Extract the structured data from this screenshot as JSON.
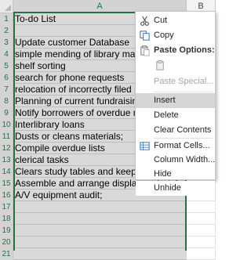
{
  "grid": {
    "columns": [
      "A",
      "B"
    ],
    "rows": [
      {
        "num": "1",
        "text": "To-do List"
      },
      {
        "num": "2",
        "text": ""
      },
      {
        "num": "3",
        "text": "Update customer Database"
      },
      {
        "num": "4",
        "text": "simple mending of library material"
      },
      {
        "num": "5",
        "text": "shelf sorting"
      },
      {
        "num": "6",
        "text": "search for phone requests"
      },
      {
        "num": "7",
        "text": "relocation of incorrectly filed mate"
      },
      {
        "num": "8",
        "text": "Planning of current fundraising driv"
      },
      {
        "num": "9",
        "text": "Notify borrowers of overdue mater"
      },
      {
        "num": "10",
        "text": "Interlibrary loans"
      },
      {
        "num": "11",
        "text": "Dusts or cleans materials;"
      },
      {
        "num": "12",
        "text": "Compile overdue lists"
      },
      {
        "num": "13",
        "text": "clerical tasks"
      },
      {
        "num": "14",
        "text": "Clears study tables and keeps furni"
      },
      {
        "num": "15",
        "text": "Assemble and arrange display materials."
      },
      {
        "num": "16",
        "text": "A/V equipment audit;"
      },
      {
        "num": "17",
        "text": ""
      },
      {
        "num": "18",
        "text": ""
      },
      {
        "num": "19",
        "text": ""
      },
      {
        "num": "20",
        "text": ""
      },
      {
        "num": "21",
        "text": ""
      }
    ]
  },
  "context_menu": {
    "cut": "Cut",
    "copy": "Copy",
    "paste_options_heading": "Paste Options:",
    "paste_special": "Paste Special...",
    "insert": "Insert",
    "delete": "Delete",
    "clear_contents": "Clear Contents",
    "format_cells": "Format Cells...",
    "column_width": "Column Width...",
    "hide": "Hide",
    "unhide": "Unhide"
  },
  "colors": {
    "accent_green": "#217346",
    "selection_fill": "#d9d9d9",
    "menu_highlight": "#d6d6d6"
  }
}
